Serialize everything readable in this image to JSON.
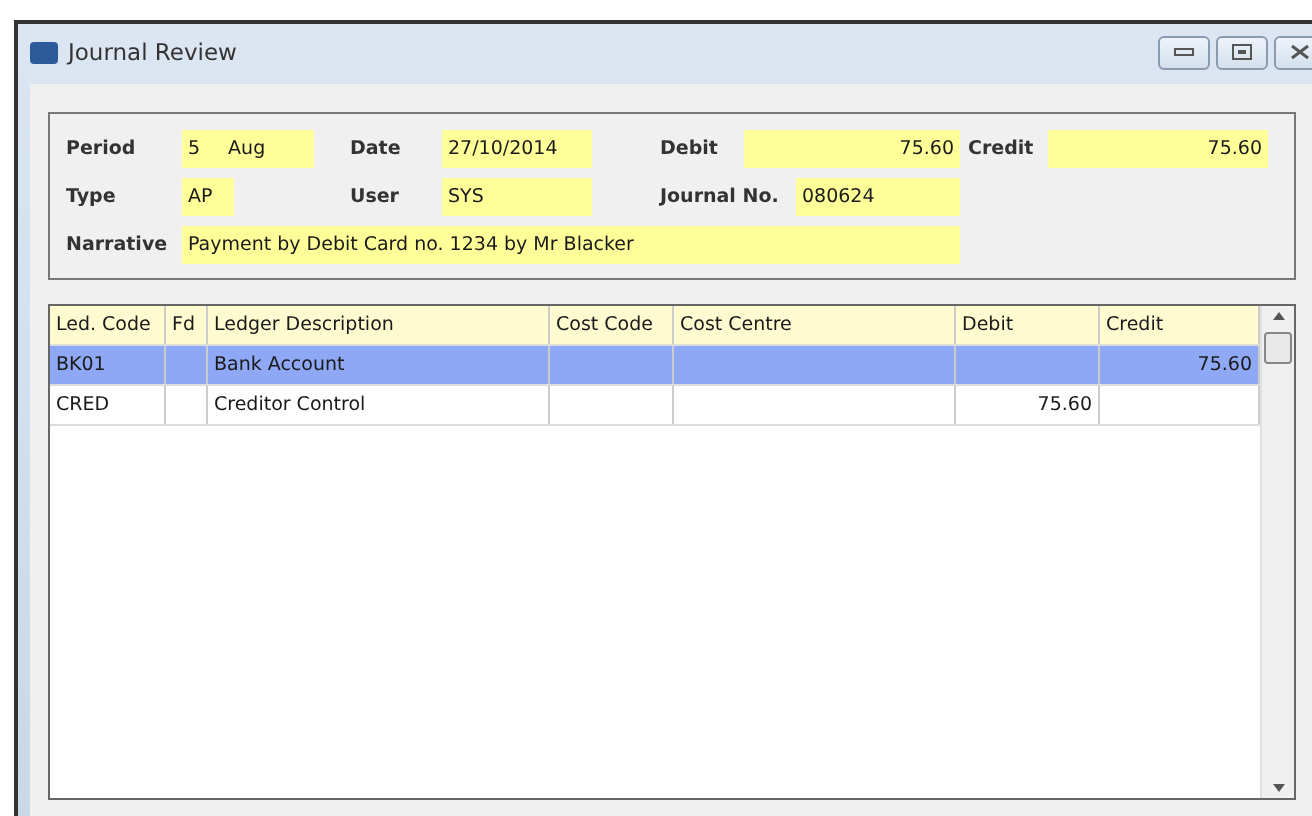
{
  "window": {
    "title": "Journal Review"
  },
  "header": {
    "period": {
      "label": "Period",
      "number": "5",
      "month": "Aug"
    },
    "date": {
      "label": "Date",
      "value": "27/10/2014"
    },
    "debit": {
      "label": "Debit",
      "value": "75.60"
    },
    "credit": {
      "label": "Credit",
      "value": "75.60"
    },
    "type": {
      "label": "Type",
      "value": "AP"
    },
    "user": {
      "label": "User",
      "value": "SYS"
    },
    "journal_no": {
      "label": "Journal No.",
      "value": "080624"
    },
    "narrative": {
      "label": "Narrative",
      "value": "Payment by Debit Card no. 1234 by Mr Blacker"
    }
  },
  "table": {
    "columns": [
      "Led. Code",
      "Fd",
      "Ledger Description",
      "Cost Code",
      "Cost Centre",
      "Debit",
      "Credit"
    ],
    "rows": [
      {
        "selected": true,
        "cells": [
          "BK01",
          "",
          "Bank Account",
          "",
          "",
          "",
          "75.60"
        ]
      },
      {
        "selected": false,
        "cells": [
          "CRED",
          "",
          "Creditor Control",
          "",
          "",
          "75.60",
          ""
        ]
      }
    ]
  }
}
